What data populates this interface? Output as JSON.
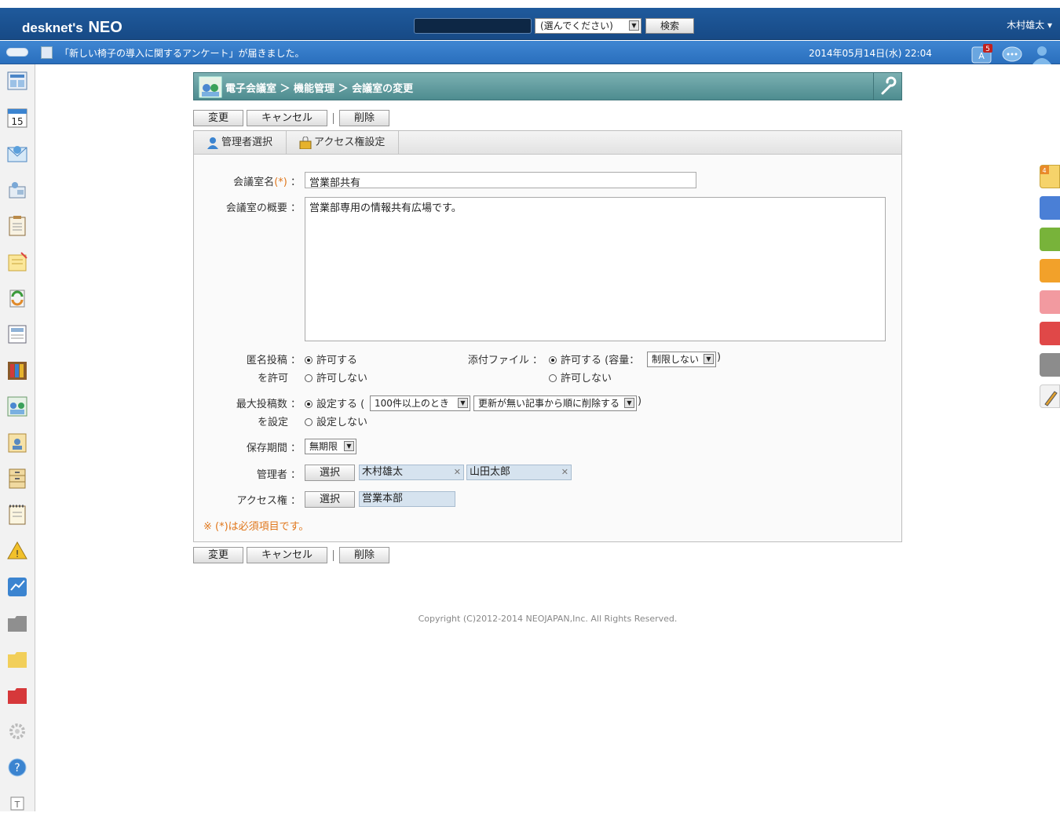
{
  "header": {
    "logo_prefix": "desknet's",
    "logo_suffix": "NEO",
    "search_placeholder": "",
    "search_select": "(選んでください)",
    "search_button": "検索",
    "user_menu": "木村雄太 ▾",
    "notice": "「新しい椅子の導入に関するアンケート」が届きました。",
    "datetime": "2014年05月14日(水) 22:04",
    "notification_badge": "5"
  },
  "icons": {
    "left_sidebar": [
      "portal-icon",
      "calendar-icon",
      "mail-icon",
      "facility-icon",
      "clipboard-icon",
      "memo-icon",
      "recycle-icon",
      "news-icon",
      "bookshelf-icon",
      "conference-icon",
      "address-icon",
      "cabinet-icon",
      "todo-icon",
      "alert-icon",
      "neo-chart-icon",
      "gray-folder-icon",
      "yellow-folder-icon",
      "red-folder-icon",
      "settings-icon",
      "help-icon",
      "text-icon"
    ],
    "calendar_day": "15",
    "sticky_count": "4"
  },
  "colors": {
    "header_bg": "#1f5a9c",
    "infobar_bg": "#3f86d2",
    "title_teal": "#4e8c90",
    "required_orange": "#e0761a",
    "right_tabs": [
      "#4a7fd6",
      "#78b33a",
      "#f2a12a",
      "#f29aa0",
      "#e04848",
      "#8c8c8c"
    ]
  },
  "breadcrumb": "電子会議室 ＞ 機能管理 ＞ 会議室の変更",
  "toolbar": {
    "change": "変更",
    "cancel": "キャンセル",
    "delete": "削除"
  },
  "tabs": [
    {
      "label": "管理者選択"
    },
    {
      "label": "アクセス権設定"
    }
  ],
  "form": {
    "room_name_label": "会議室名",
    "required_mark": "(*)",
    "colon": "：",
    "room_name_value": "営業部共有",
    "summary_label": "会議室の概要",
    "summary_value": "営業部専用の情報共有広場です。",
    "anonymous_label_1": "匿名投稿",
    "anonymous_label_2": "を許可",
    "anonymous_allow": "許可する",
    "anonymous_deny": "許可しない",
    "attach_label": "添付ファイル",
    "attach_allow": "許可する (容量：",
    "attach_capacity": "制限しない",
    "attach_close": ")",
    "attach_deny": "許可しない",
    "maxposts_label_1": "最大投稿数",
    "maxposts_label_2": "を設定",
    "maxposts_set": "設定する (",
    "maxposts_threshold": "100件以上のとき",
    "maxposts_action": "更新が無い記事から順に削除する",
    "maxposts_close": ")",
    "maxposts_unset": "設定しない",
    "retention_label": "保存期間",
    "retention_value": "無期限",
    "admin_label": "管理者",
    "select_button": "選択",
    "admins": [
      "木村雄太",
      "山田太郎"
    ],
    "access_label": "アクセス権",
    "access_groups": [
      "営業本部"
    ]
  },
  "required_note": "※ (*)は必須項目です。",
  "copyright": "Copyright (C)2012-2014 NEOJAPAN,Inc. All Rights Reserved."
}
